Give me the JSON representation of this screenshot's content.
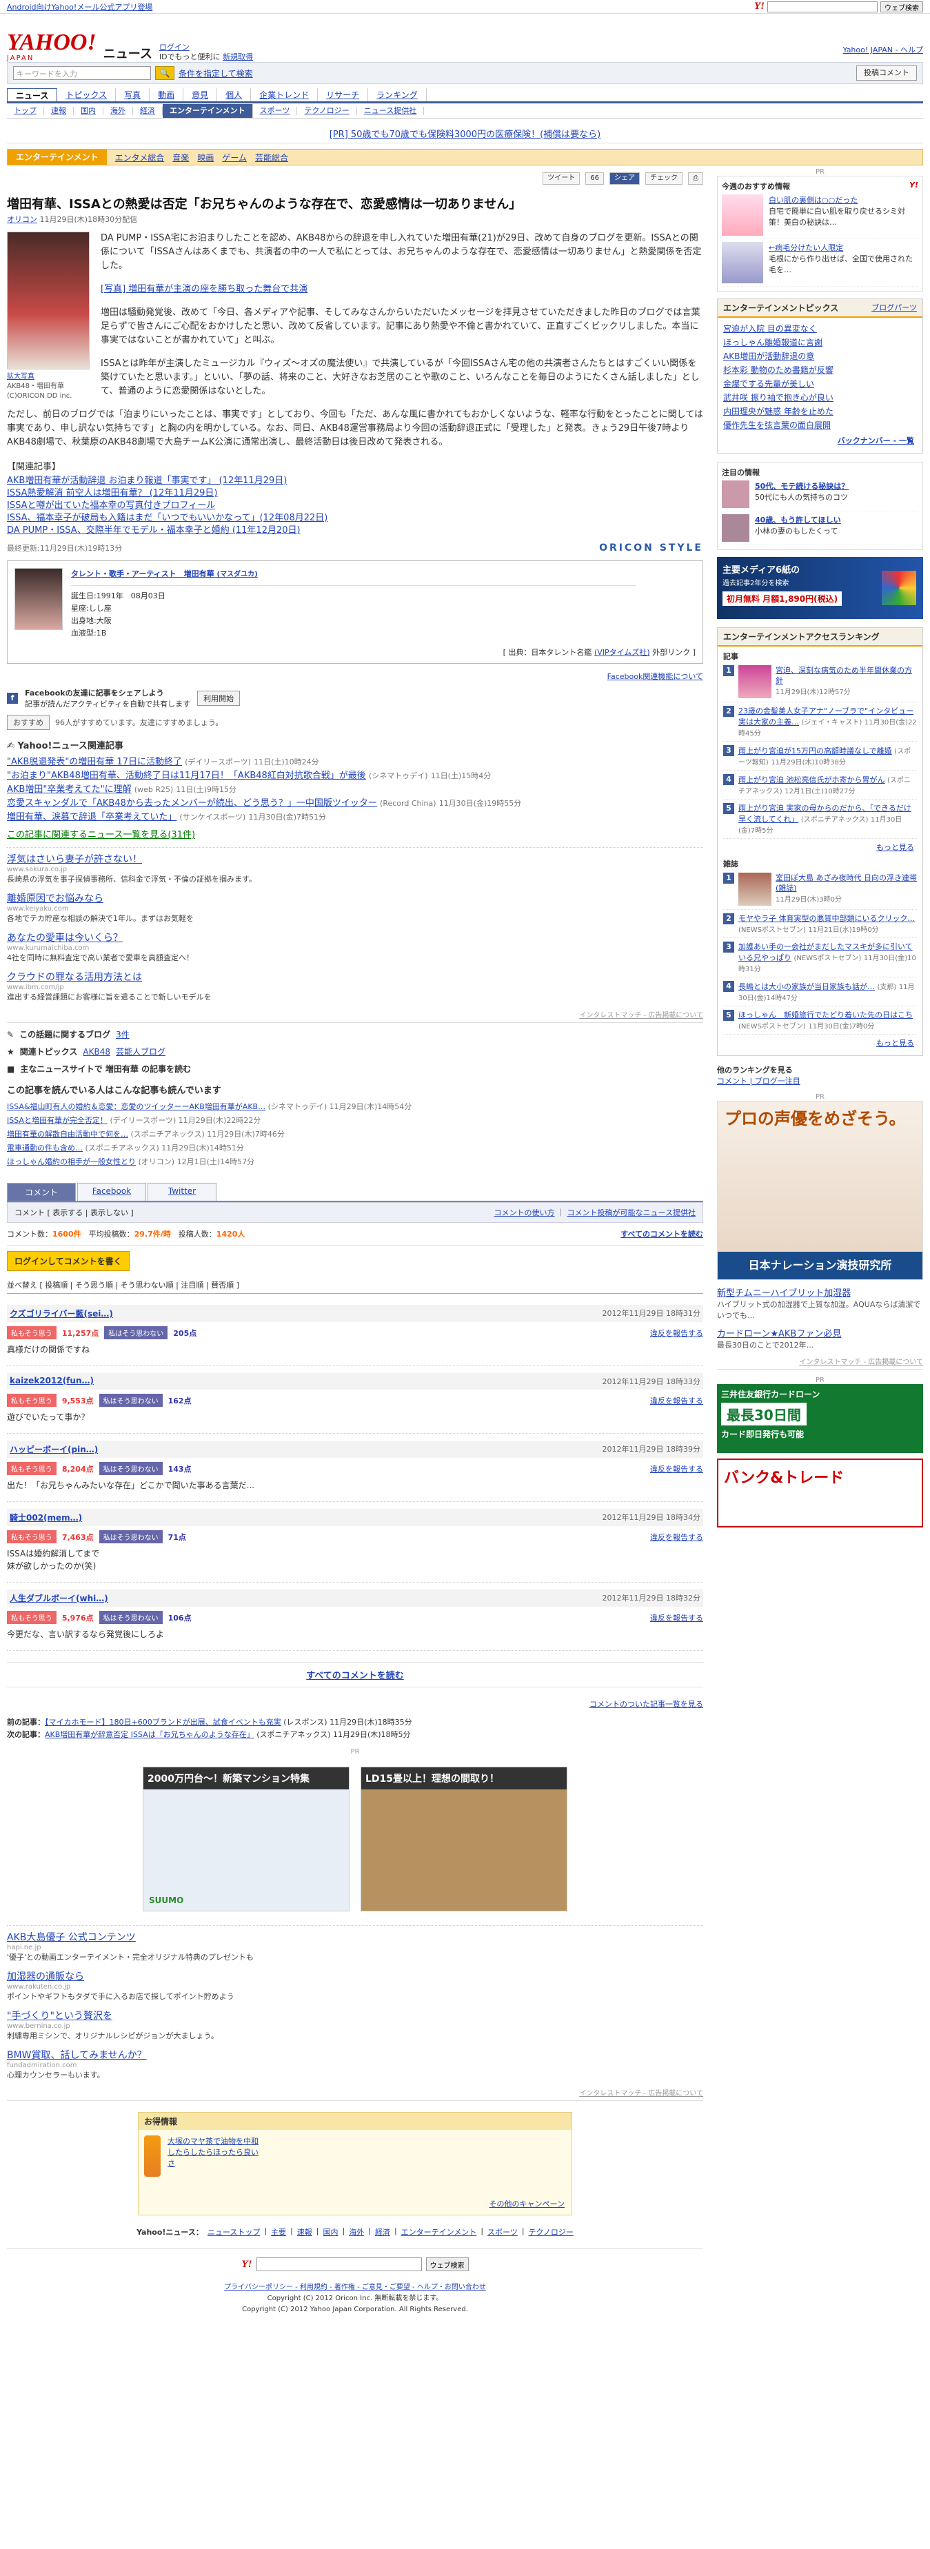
{
  "topbar": {
    "left": "Android向けYahoo!メール公式アプリ登場",
    "btn": "ウェブ検索"
  },
  "header": {
    "logo": "YAHOO!",
    "logo_sub": "JAPAN",
    "site": "ニュース",
    "login": "ログイン",
    "login_sub": "IDでもっと便利に",
    "register": "新規取得",
    "right": "Yahoo! JAPAN - ヘルプ"
  },
  "search": {
    "placeholder": "キーワードを入力",
    "cond": "条件を指定して検索",
    "post": "投稿コメント"
  },
  "nav1": [
    "ニュース",
    "トピックス",
    "写真",
    "動画",
    "意見",
    "個人",
    "企業トレンド",
    "リサーチ",
    "ランキング"
  ],
  "nav2": [
    "トップ",
    "速報",
    "国内",
    "海外",
    "経済",
    "エンターテインメント",
    "スポーツ",
    "テクノロジー",
    "ニュース提供社"
  ],
  "pr": "[PR] 50歳でも70歳でも保険料3000円の医療保険！(補償は要なら)",
  "cat": {
    "name": "エンターテインメント",
    "subs": [
      "エンタメ総合",
      "音楽",
      "映画",
      "ゲーム",
      "芸能総合"
    ]
  },
  "share": [
    "ツイート",
    "66",
    "シェア",
    "チェック"
  ],
  "article": {
    "title": "増田有華、ISSAとの熱愛は否定「お兄ちゃんのような存在で、恋愛感情は一切ありません」",
    "meta_src": "オリコン",
    "meta": "11月29日(木)18時30分配信",
    "photo_cap1": "拡大写真",
    "photo_cap2": "AKB48・増田有華",
    "photo_cap3": "(C)ORICON DD inc.",
    "p1": "DA PUMP・ISSA宅にお泊まりしたことを認め、AKB48からの辞退を申し入れていた増田有華(21)が29日、改めて自身のブログを更新。ISSAとの関係について「ISSAさんはあくまでも、共演者の中の一人で私にとっては、お兄ちゃんのような存在で、恋愛感情は一切ありません」と熱愛関係を否定した。",
    "photo_link": "[写真] 増田有華が主演の座を勝ち取った舞台で共演",
    "p2": "増田は騒動発覚後、改めて「今日、各メディアや記事、そしてみなさんからいただいたメッセージを拝見させていただきました昨日のブログでは言葉足らずで皆さんにご心配をおかけしたと思い、改めて反省しています。記事にあり熱愛や不倫と書かれていて、正直すごくビックリしました。本当に事実ではないことが書かれていて」と叫ぶ。",
    "p3": "ISSAとは昨年が主演したミュージカル『ウィズ〜オズの魔法使い』で共演しているが「今回ISSAさん宅の他の共演者さんたちとはすごくいい関係を築けていたと思います。」といい、「夢の話、将来のこと、大好きなお芝居のことや歌のこと、いろんなことを毎日のようにたくさん話しました」として、普通のように恋愛関係はないとした。",
    "p4": "ただし、前日のブログでは「泊まりにいったことは、事実です」としており、今回も「ただ、あんな風に書かれてもおかしくないような、軽率な行動をとったことに関しては事実であり、申し訳ない気持ちです」と胸の内を明かしている。なお、同日、AKB48運営事務局より今回の活動辞退正式に「受理した」と発表。きょう29日午後7時よりAKB48劇場で、秋葉原のAKB48劇場で大島チームK公演に通常出演し、最終活動日は後日改めて発表される。",
    "rel_head": "【関連記事】",
    "rel": [
      "AKB増田有華が活動辞退 お泊まり報道「事実です」 (12年11月29日)",
      "ISSA熱愛解消 前空人は増田有華？ (12年11月29日)",
      "ISSAと噂が出ていた福本幸の写真付きプロフィール",
      "ISSA、福本幸子が破局も入籍はまだ「いつでもいいかなって」(12年08月22日)",
      "DA PUMP・ISSA、交際半年でモデル・福本幸子と婚約 (11年12月20日)"
    ],
    "lastup": "最終更新:11月29日(木)19時13分",
    "oricon": "ORICON STYLE"
  },
  "talent": {
    "name": "タレント・歌手・アーティスト　増田有華",
    "kana": "(マスダユカ)",
    "birth": "誕生日:1991年　08月03日",
    "sign": "星座:しし座",
    "from": "出身地:大阪",
    "blood": "血液型:1B",
    "src": "[ 出典：日本タレント名鑑 ",
    "src_link": "(VIPタイムズ社)",
    "src2": " 外部リンク ]"
  },
  "fb": {
    "link": "Facebook関連機能について",
    "title": "Facebookの友達に記事をシェアしよう",
    "sub": "記事が読んだアクティビティを自動で共有します",
    "btn": "利用開始"
  },
  "like": {
    "btn": "おすすめ",
    "text": "96人がすすめています。友達にすすめましょう。"
  },
  "related": {
    "head": "Yahoo!ニュース関連記事",
    "items": [
      {
        "t": "\"AKB脱退発表\"の増田有華 17日に活動終了",
        "s": "(デイリースポーツ)",
        "d": "11日(土)10時24分"
      },
      {
        "t": "\"お泊まり\"AKB48増田有華、活動終了日は11月17日！「AKB48紅白対抗歌合戦」が最後",
        "s": "(シネマトゥデイ)",
        "d": "11日(土)15時4分"
      },
      {
        "t": "AKB増田\"卒業考えてた\"に理解",
        "s": "(web R25)",
        "d": "11日(土)9時15分"
      },
      {
        "t": "恋愛スキャンダルで「AKB48から去ったメンバーが続出、どう思う？」一中国版ツイッター",
        "s": "(Record China)",
        "d": "11月30日(金)19時55分"
      },
      {
        "t": "増田有華、涙暮で辞退「卒業考えていた」",
        "s": "(サンケイスポーツ)",
        "d": "11月30日(金)7時51分"
      }
    ],
    "more": "この記事に関連するニュース一覧を見る(31件)"
  },
  "ads1": [
    {
      "t": "浮気はさいら妻子が許さない！",
      "u": "www.sakura.co.jp",
      "x": "長崎県の浮気を事子探偵事務所、信科金で浮気・不倫の証拠を掴みます。"
    },
    {
      "t": "離婚原因でお悩みなら",
      "u": "www.keiyaku.com",
      "x": "各地でテカ貯産な相談の解決で1年ル。まずはお気軽を"
    },
    {
      "t": "あなたの愛車は今いくら？",
      "u": "www.kurumaichiba.com",
      "x": "4社を同時に無料査定で高い業者で愛車を高額査定へ！"
    },
    {
      "t": "クラウドの罪なる活用方法とは",
      "u": "www.ibm.com/jp",
      "x": "進出する経営課題にお客様に旨を遣ることで新しいモデルを"
    }
  ],
  "ads1_mark": "インタレストマッチ - 広告掲載について",
  "topics": {
    "label": "この話題に関するブログ",
    "count": "3件"
  },
  "topics2": {
    "label": "関連トピックス",
    "a": "AKB48",
    "b": "芸能人ブログ"
  },
  "main_news": "主なニュースサイトで 増田有華 の記事を読む",
  "also": {
    "head": "この記事を読んでいる人はこんな記事も読んでいます",
    "items": [
      "ISSA&福山町有人の婚約＆恋愛：恋愛のツイッターーAKB増田有華がAKB…",
      "ISSAと増田有華が完全否定！",
      "増田有華の解散自由活動中で何を…",
      "電車通勤の件も含め…",
      "ほっしゃん婚約の相手が一般女性とり"
    ],
    "srcs": [
      "(シネマトゥデイ)",
      "(デイリースポーツ)",
      "(スポニチアネックス)",
      "(スポニチアネックス)",
      "(オリコン)"
    ],
    "dates": [
      "11月29日(木)14時54分",
      "11月29日(木)22時22分",
      "11月29日(木)7時46分",
      "11月29日(木)14時51分",
      "12月1日(土)14時57分"
    ]
  },
  "tabs": [
    "コメント",
    "Facebook",
    "Twitter"
  ],
  "cmt": {
    "show": "コメント [ 表示する | 表示しない ]",
    "right1": "コメントの使い方",
    "right2": "コメント投稿が可能なニュース提供社",
    "count_label": "コメント数",
    "count": "1600件",
    "avg_label": "平均投稿数",
    "avg": "29.7件/時",
    "users_label": "投稿人数",
    "users": "1420人",
    "all": "すべてのコメントを読む",
    "login": "ログインしてコメントを書く",
    "sort": "並べ替え [ 投稿順 | そう思う順 | そう思わない順 | 注目順 | 賛否順 ]",
    "items": [
      {
        "u": "クズゴリライバー藍(sei…)",
        "dt": "2012年11月29日 18時31分",
        "a": "11,257点",
        "d": "205点",
        "txt": "真様だけの関係ですね"
      },
      {
        "u": "kaizek2012(fun…)",
        "dt": "2012年11月29日 18時33分",
        "a": "9,553点",
        "d": "162点",
        "txt": "遊びでいたって事か？"
      },
      {
        "u": "ハッピーボーイ(pin…)",
        "dt": "2012年11月29日 18時39分",
        "a": "8,204点",
        "d": "143点",
        "txt": "出た！「お兄ちゃんみたいな存在」どこかで聞いた事ある言葉だ..."
      },
      {
        "u": "騎士002(mem…)",
        "dt": "2012年11月29日 18時34分",
        "a": "7,463点",
        "d": "71点",
        "txt": "ISSAは婚約解消してまで\n妹が欲しかったのか(笑)"
      },
      {
        "u": "人生ダブルボーイ(whi…)",
        "dt": "2012年11月29日 18時32分",
        "a": "5,976点",
        "d": "106点",
        "txt": "今更だな、言い訳するなら発覚後にしろよ"
      }
    ],
    "agree": "私もそう思う",
    "disagree": "私はそう思わない",
    "report": "違反を報告する",
    "readall": "すべてのコメントを読む",
    "list": "コメントのついた記事一覧を見る"
  },
  "prevnext": {
    "prev_label": "前の記事：",
    "prev": "【マイカホモード】180日+600ブランドが出展、試食イベントも充実",
    "prev_src": "(レスポンス)",
    "prev_d": "11月29日(木)18時35分",
    "next_label": "次の記事：",
    "next": "AKB増田有華が辞意否定 ISSAは「お兄ちゃんのような存在」",
    "next_src": "(スポニチアネックス)",
    "next_d": "11月29日(木)18時5分"
  },
  "bigad1": {
    "h": "2000万円台～！新築マンション特集",
    "brand": "SUUMO"
  },
  "bigad2": {
    "h": "LD15畳以上！理想の間取り！"
  },
  "ads2": [
    {
      "t": "AKB大島優子 公式コンテンツ",
      "u": "hapi.ne.jp",
      "x": "'優子'との動画エンターテイメント・完全オリジナル特典のプレゼントも"
    },
    {
      "t": "加湿器の通販なら",
      "u": "www.rakuten.co.jp",
      "x": "ポイントやギフトもタダで手に入るお店で探してポイント貯めよう"
    },
    {
      "t": "\"手づくり\"という贅沢を",
      "u": "www.bernina.co.jp",
      "x": "刺繍専用ミシンで、オリジナルレシピがジョンが大ましょう。"
    },
    {
      "t": "BMW賞取、話してみませんか？",
      "u": "fundadmiration.com",
      "x": "心理カウンセラーもいます。"
    }
  ],
  "infobox": {
    "head": "お得情報",
    "text": "大塚のマヤ茶で油物を中和したらしたらほったら良いさ",
    "link": "その他のキャンペーン"
  },
  "footer": {
    "label": "Yahoo!ニュース：",
    "links": [
      "ニューストップ",
      "主要",
      "速報",
      "国内",
      "海外",
      "経済",
      "エンターテインメント",
      "スポーツ",
      "テクノロジー"
    ],
    "search_btn": "ウェブ検索",
    "policy": "プライバシーポリシー - 利用規約 - 著作権 - ご意見・ご要望 - ヘルプ・お問い合わせ",
    "copy1": "Copyright (C) 2012 Oricon Inc. 無断転載を禁じます。",
    "copy2": "Copyright (C) 2012 Yahoo Japan Corporation. All Rights Reserved."
  },
  "side": {
    "pr": "PR",
    "recommend_head": "今週のおすすめ情報",
    "rec": [
      {
        "t": "白い肌の裏側は○○だった",
        "x": "自宅で簡単に白い肌を取り戻せるシミ対策！美白の秘訣は…"
      },
      {
        "t": "←病毛分けたい人限定",
        "x": "毛根にから作り出せば、全国で使用された毛を…"
      }
    ],
    "ent_head": "エンターテインメントピックス",
    "ent_link": "ブログパーツ",
    "ent": [
      "宮迫が入院 目の異変なく",
      "ほっしゃん離婚報道に言謝",
      "AKB増田が活動辞退の意",
      "杉本彩 動物のため書籍が反響",
      "金爆でする先輩が美しい",
      "武井咲 振り袖で抱き心が良い",
      "内田理央が魅惑 年齢を止めた",
      "優作先生を弦言葉の面白展開"
    ],
    "ent_more": "バックナンバー - 一覧",
    "attn": "注目の情報",
    "attn_items": [
      {
        "t": "50代、モテ続ける秘訣は？",
        "x": "50代にも人の気持ちのコツ"
      },
      {
        "t": "40歳、もう許してほしい",
        "x": "小林の妻のもしたくって"
      }
    ],
    "cube": {
      "l1": "主要メディア6紙の",
      "l2": "過去記事2年分を検索",
      "l3": "初月無料 月額1,890円(税込)"
    },
    "rank_head": "エンターテインメントアクセスランキング",
    "rank_sub": "記事",
    "rank": [
      {
        "t": "宮迫、深刻な病気のため半年間休業の方針",
        "tm": "11月29日(木)12時57分"
      },
      {
        "t": "23歳の金髪美人女子アナ\"ノーブラで\"インタビュー 実は大家の主義…",
        "s": "(ジェイ・キャスト)",
        "tm": "11月30日(金)22時45分"
      },
      {
        "t": "雨上がり宮迫が15万円の高額時議なしで離婚",
        "s": "(スポーツ報知)",
        "tm": "11月29日(木)10時38分"
      },
      {
        "t": "雨上がり宮迫 池松亮信氏がホ寄から胃がん",
        "s": "(スポニチアネックス)",
        "tm": "12月1日(土)10時27分"
      },
      {
        "t": "雨上がり宮迫 実家の母からのだから、「できるだけ早く流してくれ」",
        "s": "(スポニチアネックス)",
        "tm": "11月30日(金)7時5分"
      }
    ],
    "rank_more": "もっと見る",
    "mag_head": "雑誌",
    "mag": [
      {
        "t": "室田ぽ大島 あざみ夜時代 日向の浮き連帯(雑誌)",
        "tm": "11月29日(木)3時0分"
      },
      {
        "t": "モヤやラ子 体育実型の悪質中部類にいるクリック...",
        "s": "(NEWSポストセブン)",
        "tm": "11月21日(水)19時0分"
      },
      {
        "t": "加護あい手の一会社がまだしたマスキが多に引いている兄やっぱり",
        "s": "(NEWSポストセブン)",
        "tm": "11月30日(金)10時31分"
      },
      {
        "t": "長嶋とは大小の家族が当日家族も話が…",
        "s": "(支那)",
        "tm": "11月30日(金)14時47分"
      },
      {
        "t": "ほっしゃん　新婚旅行でたどり着いた先の日はこち",
        "s": "(NEWSポストセブン)",
        "tm": "11月30日(金)7時0分"
      }
    ],
    "mag_more": "もっと見る",
    "other": "他のランキングを見る",
    "other_links": "コメント | ブログ一注目",
    "narr": {
      "t": "プロの声優をめざそう。",
      "b": "日本ナレーション演技研究所"
    },
    "text_ads": [
      {
        "t": "新型チムニーハイブリット加湿器",
        "x": "ハイブリット式の加湿器で上質な加湿。AQUAならば清潔でいつでも…"
      },
      {
        "t": "カードローン★AKBファン必見",
        "x": "最長30日のことで2012年…"
      }
    ],
    "smbc": {
      "t1": "三井住友銀行カードローン",
      "big": "最長30日間",
      "t2": "カード即日発行も可能"
    },
    "bank": "バンク&トレード"
  }
}
